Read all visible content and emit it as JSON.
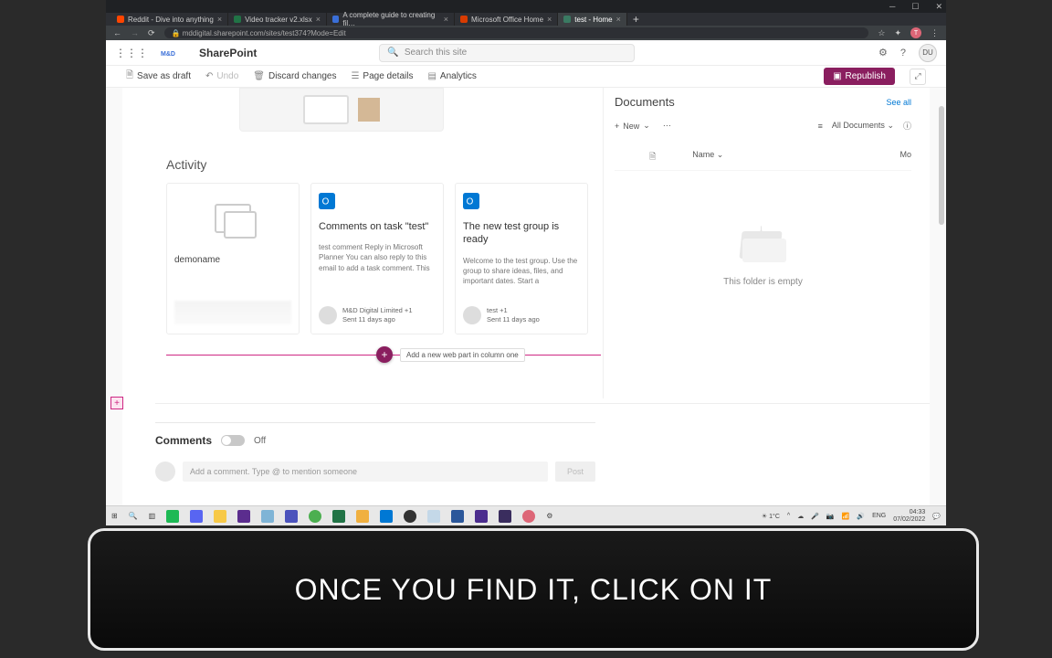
{
  "browser": {
    "tabs": [
      {
        "label": "Reddit - Dive into anything",
        "fav": "#ff4500"
      },
      {
        "label": "Video tracker v2.xlsx",
        "fav": "#217346"
      },
      {
        "label": "A complete guide to creating fil…",
        "fav": "#3a6fd8"
      },
      {
        "label": "Microsoft Office Home",
        "fav": "#d83b01"
      },
      {
        "label": "test - Home",
        "fav": "#3a7a62",
        "active": true
      }
    ],
    "url": "mddigital.sharepoint.com/sites/test374?Mode=Edit",
    "profile_initial": "T"
  },
  "suite": {
    "app": "SharePoint",
    "search_placeholder": "Search this site",
    "avatar": "DU"
  },
  "cmd": {
    "save": "Save as draft",
    "undo": "Undo",
    "discard": "Discard changes",
    "details": "Page details",
    "analytics": "Analytics",
    "republish": "Republish"
  },
  "activity": {
    "heading": "Activity",
    "card0_name": "demoname",
    "card1": {
      "title": "Comments on task \"test\"",
      "body": "test comment Reply in Microsoft Planner You can also reply to this email to add a task comment. This",
      "author": "M&D Digital Limited +1",
      "time": "Sent 11 days ago"
    },
    "card2": {
      "title": "The new test group is ready",
      "body": "Welcome to the test group. Use the group to share ideas, files, and important dates. Start a",
      "author": "test +1",
      "time": "Sent 11 days ago"
    },
    "add_web_part": "Add a new web part in column one"
  },
  "documents": {
    "heading": "Documents",
    "see_all": "See all",
    "new": "New",
    "view": "All Documents",
    "col_name": "Name",
    "col_mod": "Mo",
    "empty": "This folder is empty"
  },
  "comments": {
    "heading": "Comments",
    "state": "Off",
    "placeholder": "Add a comment. Type @ to mention someone",
    "post": "Post"
  },
  "taskbar": {
    "weather": "1°C",
    "lang": "ENG",
    "time": "04:33",
    "date": "07/02/2022"
  },
  "caption": "ONCE YOU FIND IT, CLICK ON IT"
}
